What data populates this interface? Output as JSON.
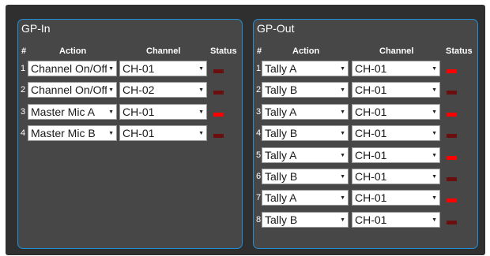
{
  "colors": {
    "led_on": "#ff0000",
    "led_off": "#6b0e0e",
    "panel_border": "#1f8fd6"
  },
  "icons": {
    "dropdown": "caret-down-icon"
  },
  "gp_in": {
    "title": "GP-In",
    "headers": {
      "num": "#",
      "action": "Action",
      "channel": "Channel",
      "status": "Status"
    },
    "rows": [
      {
        "num": "1",
        "action": "Channel On/Off",
        "channel": "CH-01",
        "status": "off"
      },
      {
        "num": "2",
        "action": "Channel On/Off",
        "channel": "CH-02",
        "status": "off"
      },
      {
        "num": "3",
        "action": "Master Mic A",
        "channel": "CH-01",
        "status": "on"
      },
      {
        "num": "4",
        "action": "Master Mic B",
        "channel": "CH-01",
        "status": "off"
      }
    ]
  },
  "gp_out": {
    "title": "GP-Out",
    "headers": {
      "num": "#",
      "action": "Action",
      "channel": "Channel",
      "status": "Status"
    },
    "rows": [
      {
        "num": "1",
        "action": "Tally A",
        "channel": "CH-01",
        "status": "on"
      },
      {
        "num": "2",
        "action": "Tally B",
        "channel": "CH-01",
        "status": "off"
      },
      {
        "num": "3",
        "action": "Tally A",
        "channel": "CH-01",
        "status": "on"
      },
      {
        "num": "4",
        "action": "Tally B",
        "channel": "CH-01",
        "status": "off"
      },
      {
        "num": "5",
        "action": "Tally A",
        "channel": "CH-01",
        "status": "on"
      },
      {
        "num": "6",
        "action": "Tally B",
        "channel": "CH-01",
        "status": "off"
      },
      {
        "num": "7",
        "action": "Tally A",
        "channel": "CH-01",
        "status": "on"
      },
      {
        "num": "8",
        "action": "Tally B",
        "channel": "CH-01",
        "status": "off"
      }
    ]
  }
}
